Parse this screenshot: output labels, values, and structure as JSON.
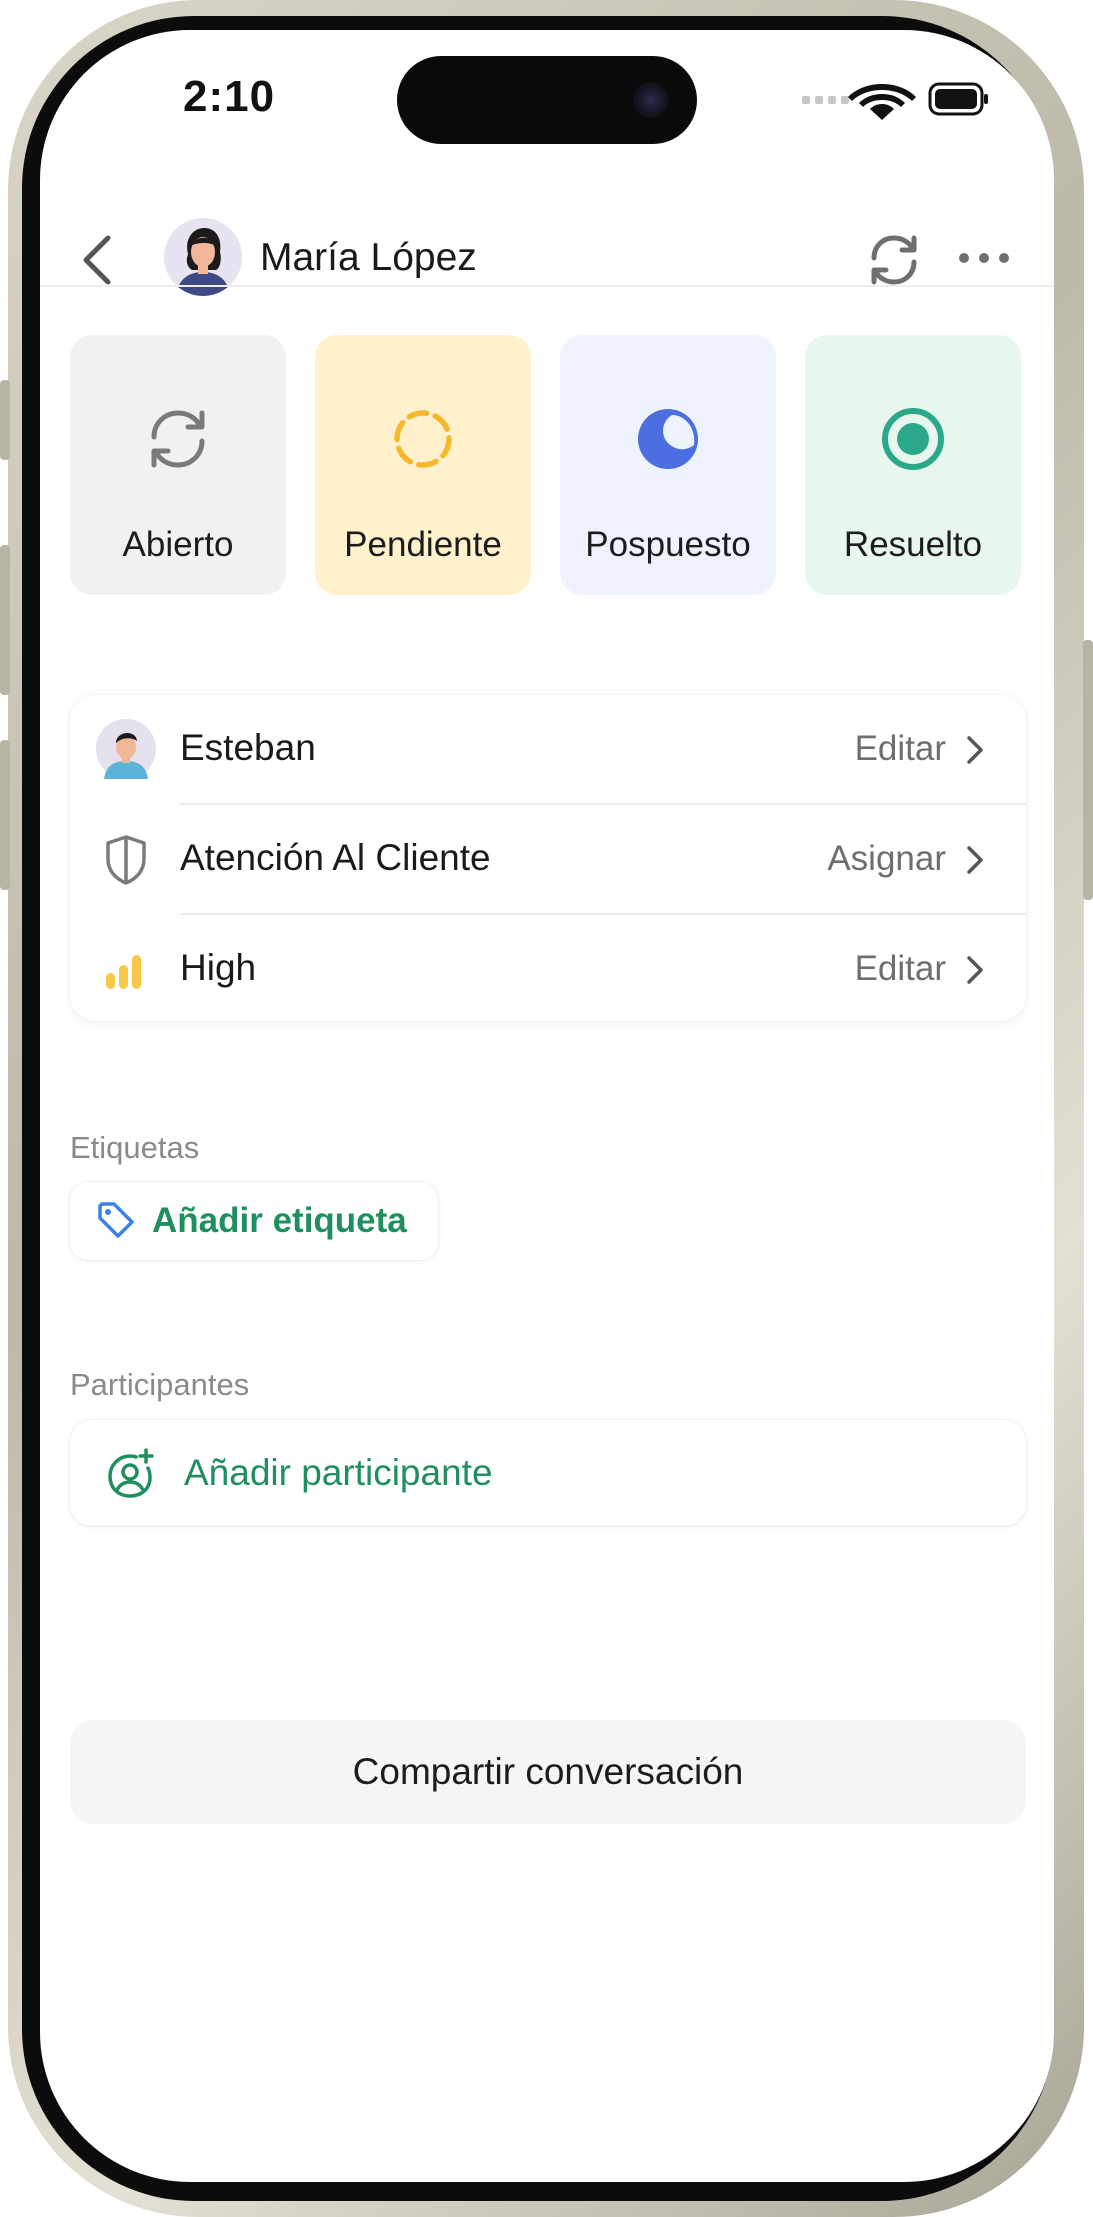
{
  "status_bar": {
    "time": "2:10"
  },
  "header": {
    "contact_name": "María López"
  },
  "status_options": [
    {
      "label": "Abierto",
      "icon": "refresh-icon",
      "bg": "#f1f1f1",
      "color": "#7a7a7a"
    },
    {
      "label": "Pendiente",
      "icon": "dashed-circle-icon",
      "bg": "#fff1cc",
      "color": "#f5b82b"
    },
    {
      "label": "Pospuesto",
      "icon": "moon-icon",
      "bg": "#eef2fd",
      "color": "#4b6ee0"
    },
    {
      "label": "Resuelto",
      "icon": "radio-selected-icon",
      "bg": "#e8f7ee",
      "color": "#2aa889"
    }
  ],
  "assignment": {
    "agent": {
      "label": "Esteban",
      "action": "Editar",
      "icon": "avatar"
    },
    "team": {
      "label": "Atención Al Cliente",
      "action": "Asignar",
      "icon": "shield-icon"
    },
    "priority": {
      "label": "High",
      "action": "Editar",
      "icon": "signal-bars-icon",
      "color": "#f7c948"
    }
  },
  "labels_section": {
    "title": "Etiquetas",
    "add_label": "Añadir etiqueta"
  },
  "participants_section": {
    "title": "Participantes",
    "add_participant": "Añadir participante"
  },
  "share_button": "Compartir conversación",
  "colors": {
    "accent_green": "#1f8f5d",
    "tag_icon_blue": "#3b82e6"
  }
}
